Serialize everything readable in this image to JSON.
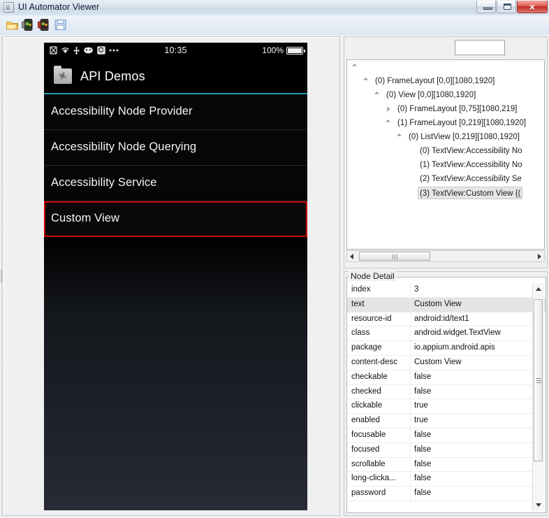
{
  "window": {
    "title": "UI Automator Viewer",
    "icon": "app-icon",
    "buttons": {
      "minimize": "minimize",
      "maximize": "maximize",
      "close": "×"
    }
  },
  "toolbar": {
    "items": [
      {
        "name": "open-file-icon",
        "label": "Open"
      },
      {
        "name": "device-screenshot-icon",
        "label": "Device Screenshot (uiautomator dump)"
      },
      {
        "name": "device-screenshot-compressed-icon",
        "label": "Device Screenshot with Compressed Hierarchy"
      },
      {
        "name": "save-icon",
        "label": "Save"
      }
    ]
  },
  "device_screen": {
    "statusbar": {
      "icons": [
        "no-sim-icon",
        "wifi-icon",
        "usb-icon",
        "android-icon",
        "calendar-icon",
        "more-dots-icon"
      ],
      "time": "10:35",
      "battery_percent": "100%",
      "battery_icon": "battery-full-icon"
    },
    "appbar": {
      "icon": "app-folder-gear-icon",
      "title": "API Demos",
      "accent_color": "#1f9bb5"
    },
    "list": {
      "items": [
        {
          "label": "Accessibility Node Provider",
          "selected": false
        },
        {
          "label": "Accessibility Node Querying",
          "selected": false
        },
        {
          "label": "Accessibility Service",
          "selected": false
        },
        {
          "label": "Custom View",
          "selected": true
        }
      ],
      "selection_outline_color": "#cc0000"
    }
  },
  "tree_panel": {
    "search_value": "",
    "search_placeholder": "",
    "rows": [
      {
        "indent": 0,
        "arrow": "expanded",
        "text": ""
      },
      {
        "indent": 16,
        "arrow": "expanded",
        "text": "(0) FrameLayout [0,0][1080,1920]"
      },
      {
        "indent": 32,
        "arrow": "expanded",
        "text": "(0) View [0,0][1080,1920]"
      },
      {
        "indent": 48,
        "arrow": "collapsed",
        "text": "(0) FrameLayout [0,75][1080,219]"
      },
      {
        "indent": 48,
        "arrow": "expanded",
        "text": "(1) FrameLayout [0,219][1080,1920]"
      },
      {
        "indent": 64,
        "arrow": "expanded",
        "text": "(0) ListView [0,219][1080,1920]"
      },
      {
        "indent": 84,
        "arrow": "none",
        "text": "(0) TextView:Accessibility No"
      },
      {
        "indent": 84,
        "arrow": "none",
        "text": "(1) TextView:Accessibility No"
      },
      {
        "indent": 84,
        "arrow": "none",
        "text": "(2) TextView:Accessibility Se"
      },
      {
        "indent": 84,
        "arrow": "none",
        "text": "(3) TextView:Custom View {(",
        "selected": true
      }
    ],
    "hscroll": {
      "left_arrow": "scroll-left-icon",
      "right_arrow": "scroll-right-icon"
    }
  },
  "node_detail": {
    "legend": "Node Detail",
    "rows": [
      {
        "key": "index",
        "value": "3",
        "selected": false
      },
      {
        "key": "text",
        "value": "Custom View",
        "selected": true
      },
      {
        "key": "resource-id",
        "value": "android:id/text1",
        "selected": false
      },
      {
        "key": "class",
        "value": "android.widget.TextView",
        "selected": false
      },
      {
        "key": "package",
        "value": "io.appium.android.apis",
        "selected": false
      },
      {
        "key": "content-desc",
        "value": "Custom View",
        "selected": false
      },
      {
        "key": "checkable",
        "value": "false",
        "selected": false
      },
      {
        "key": "checked",
        "value": "false",
        "selected": false
      },
      {
        "key": "clickable",
        "value": "true",
        "selected": false
      },
      {
        "key": "enabled",
        "value": "true",
        "selected": false
      },
      {
        "key": "focusable",
        "value": "false",
        "selected": false
      },
      {
        "key": "focused",
        "value": "false",
        "selected": false
      },
      {
        "key": "scrollable",
        "value": "false",
        "selected": false
      },
      {
        "key": "long-clicka...",
        "value": "false",
        "selected": false
      },
      {
        "key": "password",
        "value": "false",
        "selected": false
      }
    ],
    "vscroll": {
      "up_arrow": "scroll-up-icon",
      "down_arrow": "scroll-down-icon"
    }
  }
}
